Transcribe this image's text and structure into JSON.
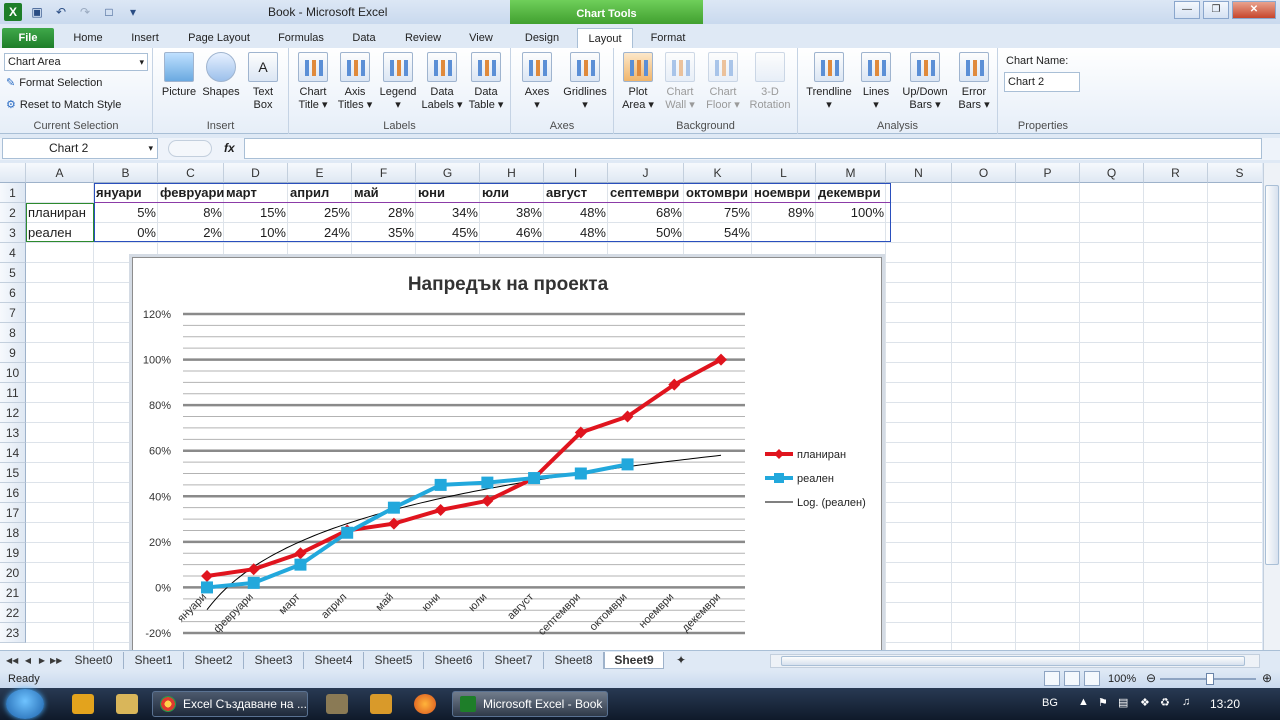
{
  "window": {
    "title": "Book  -  Microsoft Excel",
    "chart_tools": "Chart Tools"
  },
  "tabs": [
    "File",
    "Home",
    "Insert",
    "Page Layout",
    "Formulas",
    "Data",
    "Review",
    "View",
    "Design",
    "Layout",
    "Format"
  ],
  "active_tab": "Layout",
  "ribbon": {
    "current_selection": {
      "label": "Current Selection",
      "dropdown_value": "Chart Area",
      "format_selection": "Format Selection",
      "reset_style": "Reset to Match Style"
    },
    "insert": {
      "label": "Insert",
      "picture": "Picture",
      "shapes": "Shapes",
      "text_box_1": "Text",
      "text_box_2": "Box"
    },
    "labels": {
      "label": "Labels",
      "chart_title_1": "Chart",
      "chart_title_2": "Title ▾",
      "axis_titles_1": "Axis",
      "axis_titles_2": "Titles ▾",
      "legend_1": "Legend",
      "legend_2": "▾",
      "data_labels_1": "Data",
      "data_labels_2": "Labels ▾",
      "data_table_1": "Data",
      "data_table_2": "Table ▾"
    },
    "axes": {
      "label": "Axes",
      "axes_1": "Axes",
      "axes_2": "▾",
      "gridlines_1": "Gridlines",
      "gridlines_2": "▾"
    },
    "background": {
      "label": "Background",
      "plot_area_1": "Plot",
      "plot_area_2": "Area ▾",
      "chart_wall_1": "Chart",
      "chart_wall_2": "Wall ▾",
      "chart_floor_1": "Chart",
      "chart_floor_2": "Floor ▾",
      "rotation_1": "3-D",
      "rotation_2": "Rotation"
    },
    "analysis": {
      "label": "Analysis",
      "trendline_1": "Trendline",
      "trendline_2": "▾",
      "lines_1": "Lines",
      "lines_2": "▾",
      "updown_1": "Up/Down",
      "updown_2": "Bars ▾",
      "error_1": "Error",
      "error_2": "Bars ▾"
    },
    "properties": {
      "label": "Properties",
      "chart_name_label": "Chart Name:",
      "chart_name_value": "Chart 2"
    }
  },
  "formula_bar": {
    "name_box": "Chart 2",
    "fx": "fx",
    "content": ""
  },
  "columns": [
    "A",
    "B",
    "C",
    "D",
    "E",
    "F",
    "G",
    "H",
    "I",
    "J",
    "K",
    "L",
    "M",
    "N",
    "O",
    "P",
    "Q",
    "R",
    "S"
  ],
  "rows": [
    "1",
    "2",
    "3",
    "4",
    "5",
    "6",
    "7",
    "8",
    "9",
    "10",
    "11",
    "12",
    "13",
    "14",
    "15",
    "16",
    "17",
    "18",
    "19",
    "20",
    "21",
    "22",
    "23"
  ],
  "table": {
    "months": [
      "януари",
      "февруари",
      "март",
      "април",
      "май",
      "юни",
      "юли",
      "август",
      "септември",
      "октомври",
      "ноември",
      "декември"
    ],
    "planned_label": "планиран",
    "planned": [
      "5%",
      "8%",
      "15%",
      "25%",
      "28%",
      "34%",
      "38%",
      "48%",
      "68%",
      "75%",
      "89%",
      "100%"
    ],
    "actual_label": "реален",
    "actual": [
      "0%",
      "2%",
      "10%",
      "24%",
      "35%",
      "45%",
      "46%",
      "48%",
      "50%",
      "54%",
      "",
      ""
    ]
  },
  "chart_data": {
    "type": "line",
    "title": "Напредък на проекта",
    "categories": [
      "януари",
      "февруари",
      "март",
      "април",
      "май",
      "юни",
      "юли",
      "август",
      "септември",
      "октомври",
      "ноември",
      "декември"
    ],
    "series": [
      {
        "name": "планиран",
        "values": [
          5,
          8,
          15,
          25,
          28,
          34,
          38,
          48,
          68,
          75,
          89,
          100
        ],
        "color": "#e0141e",
        "marker": "diamond"
      },
      {
        "name": "реален",
        "values": [
          0,
          2,
          10,
          24,
          35,
          45,
          46,
          48,
          50,
          54,
          null,
          null
        ],
        "color": "#22a8dc",
        "marker": "square"
      }
    ],
    "trendline": {
      "name": "Log. (реален)",
      "type": "logarithmic",
      "color": "#000000"
    },
    "ylim": [
      -20,
      120
    ],
    "ytick_labels": [
      "-20%",
      "0%",
      "20%",
      "40%",
      "60%",
      "80%",
      "100%",
      "120%"
    ],
    "y_unit": "%",
    "grid": true,
    "legend_position": "right"
  },
  "sheets": [
    "Sheet0",
    "Sheet1",
    "Sheet2",
    "Sheet3",
    "Sheet4",
    "Sheet5",
    "Sheet6",
    "Sheet7",
    "Sheet8",
    "Sheet9"
  ],
  "active_sheet": "Sheet9",
  "status": {
    "ready": "Ready",
    "zoom": "100%"
  },
  "taskbar": {
    "task1": "Excel Създаване на ...",
    "task2": "Microsoft Excel - Book",
    "lang": "BG",
    "clock": "13:20"
  }
}
